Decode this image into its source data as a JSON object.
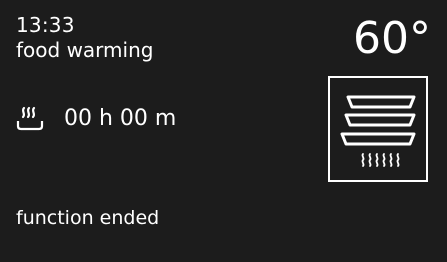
{
  "display": {
    "time": "13:33",
    "mode": "food warming",
    "temperature": "60°",
    "duration": "00 h 00 m",
    "status": "function ended"
  },
  "icons": {
    "duration_icon": "plate-warming-icon",
    "function_icon": "stacked-plates-bottom-heat-icon"
  },
  "colors": {
    "background": "#1c1c1c",
    "foreground": "#ffffff"
  }
}
